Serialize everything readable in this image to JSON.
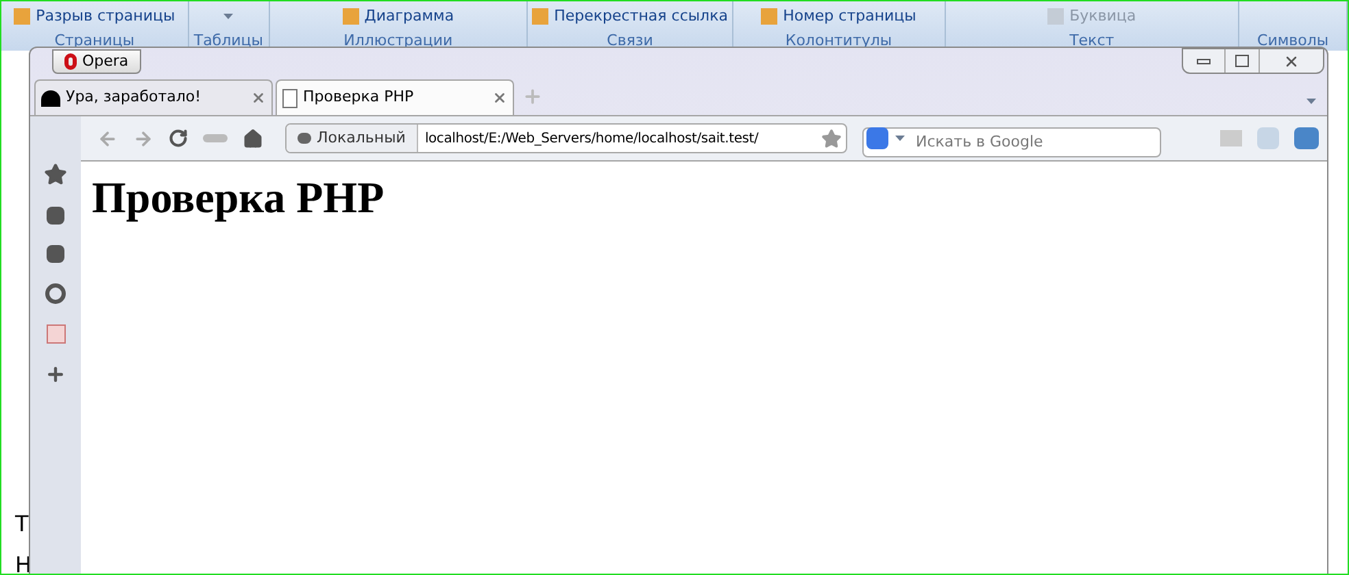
{
  "ribbon": {
    "groups": [
      {
        "name": "Страницы",
        "button": "Разрыв страницы",
        "disabled": false
      },
      {
        "name": "Таблицы"
      },
      {
        "name": "Иллюстрации",
        "button": "Диаграмма",
        "disabled": false
      },
      {
        "name": "Связи",
        "button": "Перекрестная ссылка",
        "disabled": false
      },
      {
        "name": "Колонтитулы",
        "button": "Номер страницы",
        "disabled": false
      },
      {
        "name": "Текст",
        "button": "Буквица",
        "disabled": true
      },
      {
        "name": "Символы"
      }
    ]
  },
  "document": {
    "margin_letters": [
      "Т",
      "Н"
    ]
  },
  "browser": {
    "menu_button": "Opera",
    "tabs": [
      {
        "title": "Ура, заработало!",
        "selected": false
      },
      {
        "title": "Проверка PHP",
        "selected": true
      }
    ],
    "address": {
      "zone": "Локальный",
      "url": "localhost/E:/Web_Servers/home/localhost/sait.test/"
    },
    "search": {
      "placeholder": "Искать в Google"
    },
    "page": {
      "heading": "Проверка PHP"
    }
  }
}
